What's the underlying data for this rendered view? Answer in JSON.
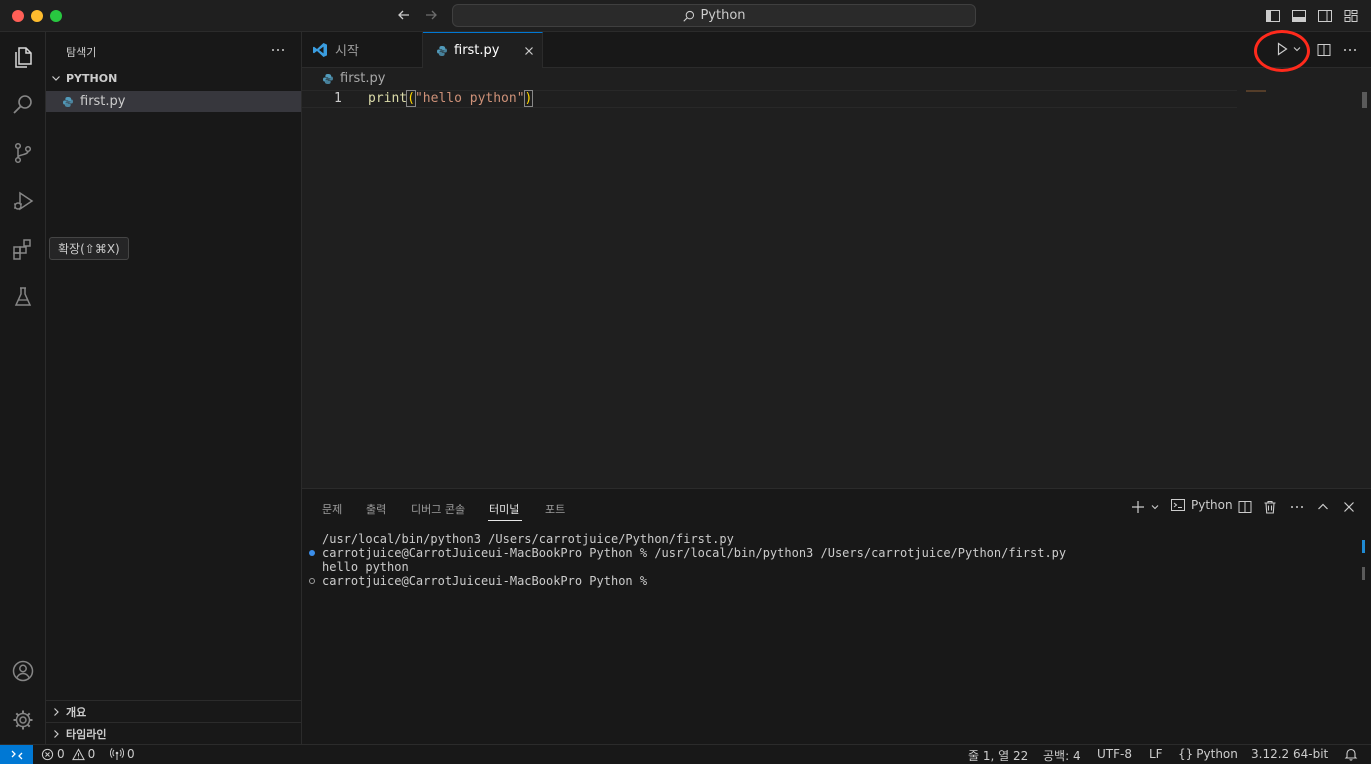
{
  "window": {
    "search_label": "Python"
  },
  "activity": {
    "tooltip": "확장(⇧⌘X)"
  },
  "sidebar": {
    "title": "탐색기",
    "folder": "PYTHON",
    "file": "first.py",
    "outline": "개요",
    "timeline": "타임라인"
  },
  "tabs": [
    {
      "label": "시작"
    },
    {
      "label": "first.py"
    }
  ],
  "editor": {
    "breadcrumb": "first.py",
    "line_number": "1",
    "code_fn": "print",
    "code_open": "(",
    "code_str": "\"hello python\"",
    "code_close": ")"
  },
  "panel": {
    "tabs": [
      "문제",
      "출력",
      "디버그 콘솔",
      "터미널",
      "포트"
    ],
    "terminal_label": "Python",
    "lines": [
      "/usr/local/bin/python3 /Users/carrotjuice/Python/first.py",
      "carrotjuice@CarrotJuiceui-MacBookPro Python % /usr/local/bin/python3 /Users/carrotjuice/Python/first.py",
      "hello python",
      "carrotjuice@CarrotJuiceui-MacBookPro Python %"
    ]
  },
  "status": {
    "errors": "0",
    "warnings": "0",
    "ports": "0",
    "position": "줄 1, 열 22",
    "spaces": "공백: 4",
    "encoding": "UTF-8",
    "eol": "LF",
    "language": "Python",
    "interpreter": "3.12.2 64-bit"
  },
  "colors": {
    "accent": "#0078d4",
    "highlight_circle": "#ff2a1c",
    "code_function": "#dcdcaa",
    "code_string": "#ce9178",
    "python_icon": "#519aba"
  }
}
